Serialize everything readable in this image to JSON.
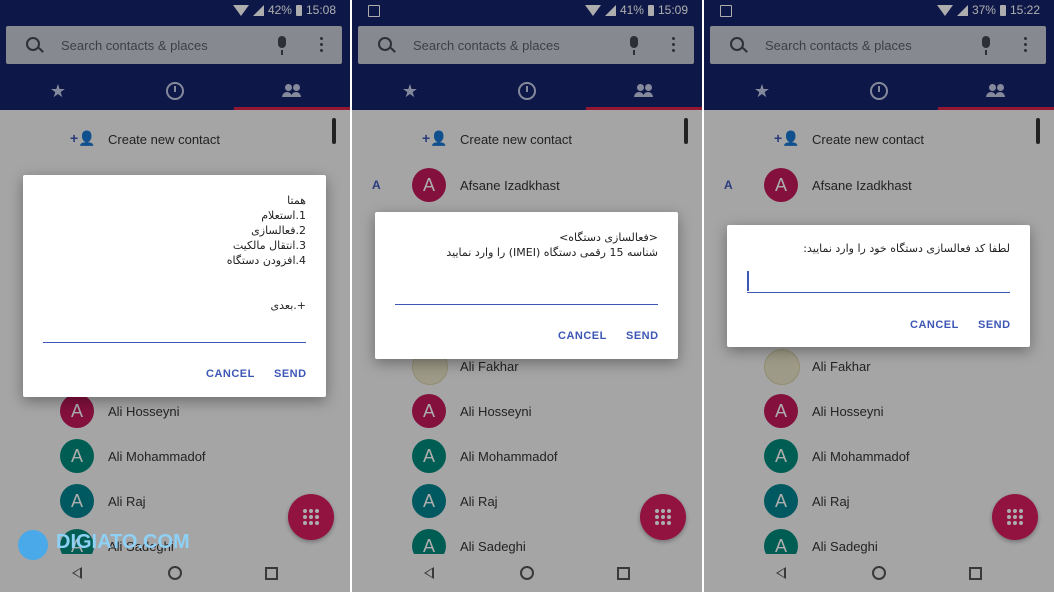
{
  "phones": [
    {
      "status": {
        "battery": "42%",
        "time": "15:08"
      },
      "search_placeholder": "Search contacts & places",
      "create_contact": "Create new contact",
      "contacts": [
        {
          "letter": "",
          "avatar": "A",
          "name": "Ali Hosseyni",
          "color": "pink"
        },
        {
          "letter": "",
          "avatar": "A",
          "name": "Ali Mohammadof",
          "color": "teal"
        },
        {
          "letter": "",
          "avatar": "A",
          "name": "Ali Raj",
          "color": "tealb"
        },
        {
          "letter": "",
          "avatar": "A",
          "name": "Ali Sadeghi",
          "color": "teal"
        }
      ],
      "dialog": {
        "message": "همتا\n1.استعلام\n2.فعالسازی\n3.انتقال مالکیت\n4.افزودن دستگاه\n\n\n+.بعدی",
        "cancel": "CANCEL",
        "send": "SEND"
      }
    },
    {
      "status": {
        "battery": "41%",
        "time": "15:09"
      },
      "search_placeholder": "Search contacts & places",
      "create_contact": "Create new contact",
      "section_letter": "A",
      "contacts": [
        {
          "avatar": "A",
          "name": "Afsane Izadkhast",
          "color": "pink"
        },
        {
          "avatar": "",
          "name": "Ali Fakhar",
          "color": "photo"
        },
        {
          "avatar": "A",
          "name": "Ali Hosseyni",
          "color": "pink"
        },
        {
          "avatar": "A",
          "name": "Ali Mohammadof",
          "color": "teal"
        },
        {
          "avatar": "A",
          "name": "Ali Raj",
          "color": "tealb"
        },
        {
          "avatar": "A",
          "name": "Ali Sadeghi",
          "color": "teal"
        }
      ],
      "dialog": {
        "message": "<فعالسازی دستگاه>\nشناسه 15 رقمی دستگاه (IMEI) را وارد نمایید",
        "cancel": "CANCEL",
        "send": "SEND"
      }
    },
    {
      "status": {
        "battery": "37%",
        "time": "15:22"
      },
      "search_placeholder": "Search contacts & places",
      "create_contact": "Create new contact",
      "section_letter": "A",
      "contacts": [
        {
          "avatar": "A",
          "name": "Afsane Izadkhast",
          "color": "pink"
        },
        {
          "avatar": "",
          "name": "Ali Fakhar",
          "color": "photo"
        },
        {
          "avatar": "A",
          "name": "Ali Hosseyni",
          "color": "pink"
        },
        {
          "avatar": "A",
          "name": "Ali Mohammadof",
          "color": "teal"
        },
        {
          "avatar": "A",
          "name": "Ali Raj",
          "color": "tealb"
        },
        {
          "avatar": "A",
          "name": "Ali Sadeghi",
          "color": "teal"
        }
      ],
      "dialog": {
        "message": "لطفا کد فعالسازی دستگاه خود را وارد نمایید:",
        "cancel": "CANCEL",
        "send": "SEND"
      }
    }
  ],
  "watermark": "DIGIATO.COM",
  "colors": {
    "appbar": "#15246b",
    "accent": "#3d57b5",
    "fab": "#d81b5f",
    "tab_indicator": "#d9224b"
  }
}
